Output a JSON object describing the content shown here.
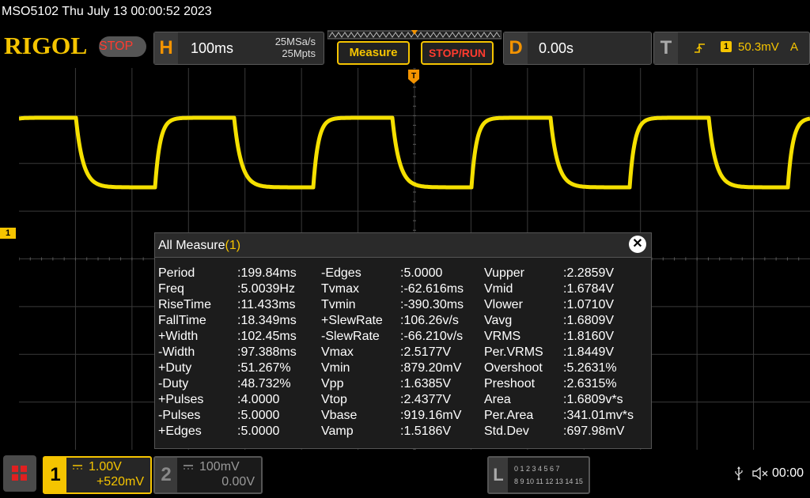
{
  "title": "MSO5102  Thu July 13 00:00:52 2023",
  "logo": "RIGOL",
  "status_button": "STOP",
  "horizontal": {
    "letter": "H",
    "timebase": "100ms",
    "sample_rate": "25MSa/s",
    "memory_depth": "25Mpts"
  },
  "buttons": {
    "measure": "Measure",
    "stop_run": "STOP/RUN"
  },
  "delay": {
    "letter": "D",
    "value": "0.00s"
  },
  "trigger": {
    "letter": "T",
    "channel": "1",
    "level": "50.3mV",
    "coupling": "A",
    "marker_label": "T"
  },
  "ch1_marker": "1",
  "measure_panel": {
    "title": "All Measure",
    "channel": "(1)",
    "close": "✕",
    "columns": [
      [
        {
          "k": "Period",
          "v": ":199.84ms"
        },
        {
          "k": "Freq",
          "v": ":5.0039Hz"
        },
        {
          "k": "RiseTime",
          "v": ":11.433ms"
        },
        {
          "k": "FallTime",
          "v": ":18.349ms"
        },
        {
          "k": "+Width",
          "v": ":102.45ms"
        },
        {
          "k": "-Width",
          "v": ":97.388ms"
        },
        {
          "k": "+Duty",
          "v": ":51.267%"
        },
        {
          "k": "-Duty",
          "v": ":48.732%"
        },
        {
          "k": "+Pulses",
          "v": ":4.0000"
        },
        {
          "k": "-Pulses",
          "v": ":5.0000"
        },
        {
          "k": "+Edges",
          "v": ":5.0000"
        }
      ],
      [
        {
          "k": "-Edges",
          "v": ":5.0000"
        },
        {
          "k": "Tvmax",
          "v": ":-62.616ms"
        },
        {
          "k": "Tvmin",
          "v": ":-390.30ms"
        },
        {
          "k": "+SlewRate",
          "v": ":106.26v/s"
        },
        {
          "k": "-SlewRate",
          "v": ":-66.210v/s"
        },
        {
          "k": "Vmax",
          "v": ":2.5177V"
        },
        {
          "k": "Vmin",
          "v": ":879.20mV"
        },
        {
          "k": "Vpp",
          "v": ":1.6385V"
        },
        {
          "k": "Vtop",
          "v": ":2.4377V"
        },
        {
          "k": "Vbase",
          "v": ":919.16mV"
        },
        {
          "k": "Vamp",
          "v": ":1.5186V"
        }
      ],
      [
        {
          "k": "Vupper",
          "v": ":2.2859V"
        },
        {
          "k": "Vmid",
          "v": ":1.6784V"
        },
        {
          "k": "Vlower",
          "v": ":1.0710V"
        },
        {
          "k": "Vavg",
          "v": ":1.6809V"
        },
        {
          "k": "VRMS",
          "v": ":1.8160V"
        },
        {
          "k": "Per.VRMS",
          "v": ":1.8449V"
        },
        {
          "k": "Overshoot",
          "v": ":5.2631%"
        },
        {
          "k": "Preshoot",
          "v": ":2.6315%"
        },
        {
          "k": "Area",
          "v": ":1.6809v*s"
        },
        {
          "k": "Per.Area",
          "v": ":341.01mv*s"
        },
        {
          "k": "Std.Dev",
          "v": ":697.98mV"
        }
      ]
    ]
  },
  "channels": [
    {
      "num": "1",
      "scale": "1.00V",
      "offset": "+520mV",
      "color": "#f5c400",
      "active": true
    },
    {
      "num": "2",
      "scale": "100mV",
      "offset": "0.00V",
      "color": "#999999",
      "active": false
    }
  ],
  "logic": {
    "letter": "L",
    "row1": "0 1 2 3  4 5 6 7",
    "row2": "8 9 10 11 12 13 14 15"
  },
  "clock": "00:00",
  "colors": {
    "accent": "#f5c400",
    "orange": "#f39300",
    "stop_red": "#ff3b2f",
    "background": "#000000",
    "grid": "#444444"
  }
}
